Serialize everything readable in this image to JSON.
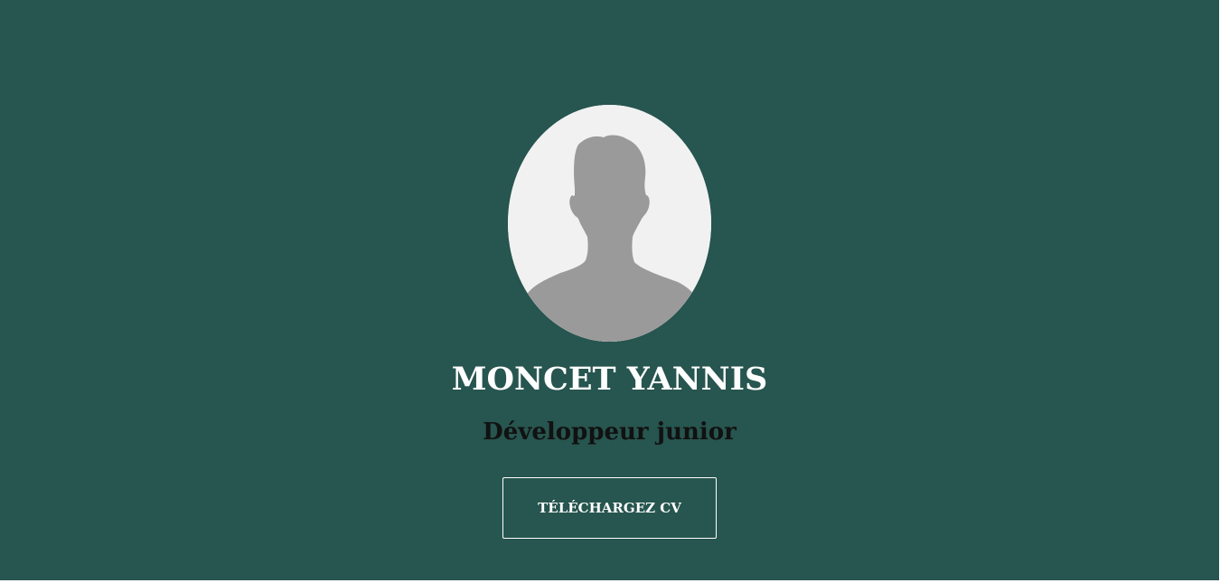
{
  "profile": {
    "avatar_icon": "user-silhouette-icon",
    "name": "MONCET YANNIS",
    "role": "Développeur junior"
  },
  "actions": {
    "download_cv_label": "TÉLÉCHARGEZ CV"
  },
  "colors": {
    "background": "#27554f",
    "avatar_background": "#f1f1f1",
    "silhouette": "#9a9a9a",
    "name_text": "#ffffff",
    "role_text": "#111111",
    "button_border": "#ffffff"
  }
}
